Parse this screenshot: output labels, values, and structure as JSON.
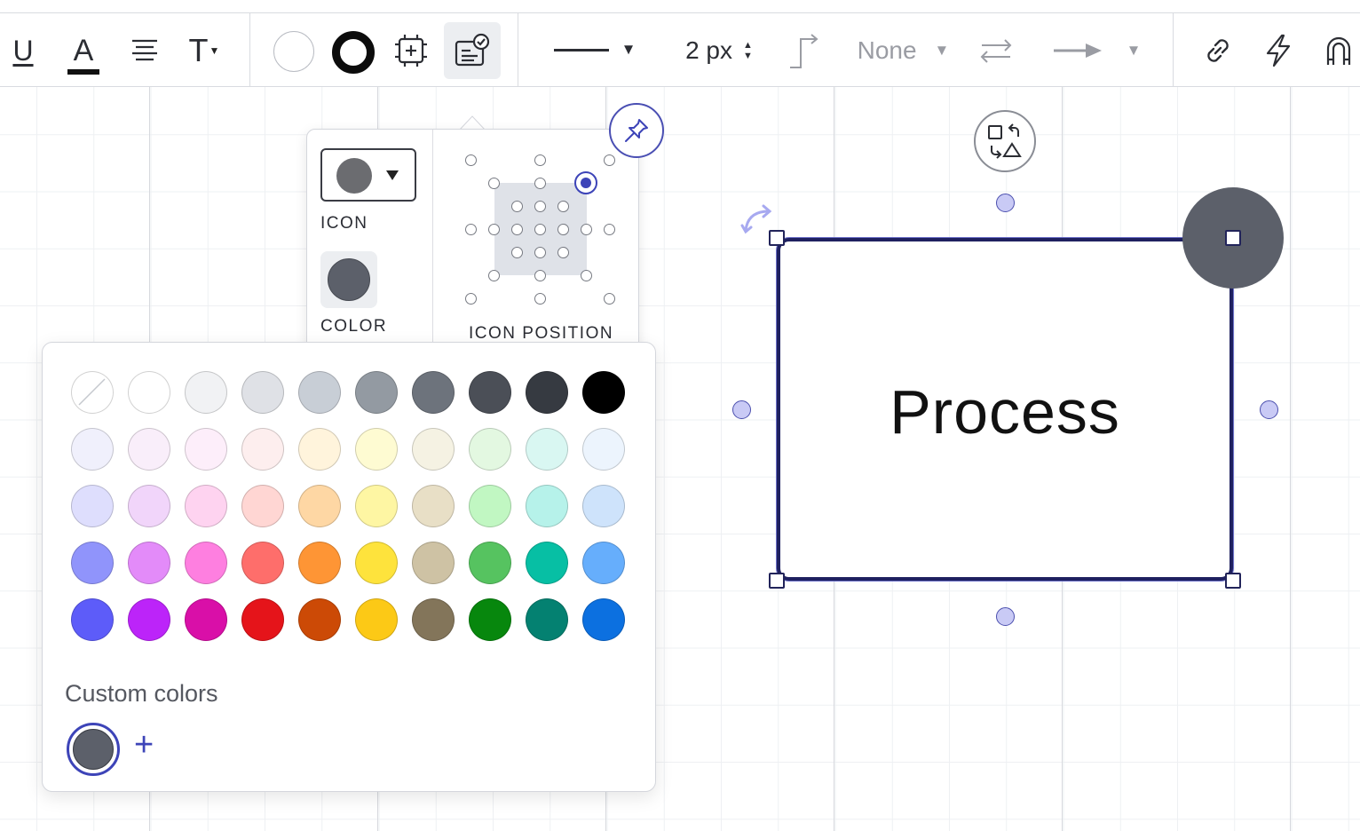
{
  "toolbar": {
    "underline_glyph": "U",
    "text_color_glyph": "A",
    "text_size_glyph": "T",
    "line_width": "2 px",
    "line_end_label": "None",
    "colors": {
      "text_color_bar": "#111111",
      "selected_tool_bg": "#eceef1"
    }
  },
  "icon_panel": {
    "icon_label": "ICON",
    "color_label": "COLOR",
    "icon_position_label": "ICON POSITION",
    "icon_swatch_color": "#6b6c70",
    "color_value": "#5c606a"
  },
  "palette": {
    "rows": [
      [
        "none",
        "#ffffff",
        "#f1f2f4",
        "#dfe1e6",
        "#c8ced6",
        "#939aa2",
        "#6d737c",
        "#4b4f57",
        "#363a41",
        "#000000"
      ],
      [
        "#f0f0fc",
        "#f9eefa",
        "#fdeefa",
        "#fdeeee",
        "#fff4dc",
        "#fefbd2",
        "#f5f2e3",
        "#e3f8e1",
        "#d9f7f2",
        "#ecf4fd"
      ],
      [
        "#dedefd",
        "#f1d5fa",
        "#fed3f0",
        "#ffd6d3",
        "#fed7a4",
        "#fef6a3",
        "#e8dfc6",
        "#c1f7c2",
        "#b6f2ea",
        "#cee3fb"
      ],
      [
        "#9094fb",
        "#e38bf9",
        "#fe7fe0",
        "#fe6e6b",
        "#fe9535",
        "#fee33c",
        "#cec2a4",
        "#56c360",
        "#07bfa4",
        "#66aefc"
      ],
      [
        "#5d5cf9",
        "#bc24f9",
        "#d90fa8",
        "#e5141a",
        "#cc4a06",
        "#fcc916",
        "#83755a",
        "#07870d",
        "#048171",
        "#0c70e0"
      ]
    ],
    "custom_colors_label": "Custom colors",
    "custom_colors": [
      "#5c606a"
    ],
    "add_label": "+"
  },
  "shape": {
    "label": "Process",
    "border_color": "#1f2160",
    "icon_color": "#5c606a"
  }
}
